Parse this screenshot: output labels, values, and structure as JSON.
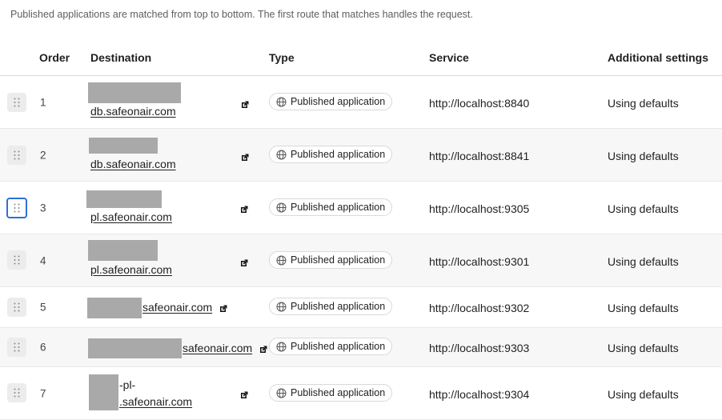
{
  "description": "Published applications are matched from top to bottom. The first route that matches handles the request.",
  "columns": {
    "order": "Order",
    "destination": "Destination",
    "type": "Type",
    "service": "Service",
    "settings": "Additional settings"
  },
  "rows": [
    {
      "order": "1",
      "domain": "db.safeonair.com",
      "type": "Published application",
      "service": "http://localhost:8840",
      "settings": "Using defaults"
    },
    {
      "order": "2",
      "domain": "db.safeonair.com",
      "type": "Published application",
      "service": "http://localhost:8841",
      "settings": "Using defaults"
    },
    {
      "order": "3",
      "domain": "pl.safeonair.com",
      "type": "Published application",
      "service": "http://localhost:9305",
      "settings": "Using defaults"
    },
    {
      "order": "4",
      "domain": "pl.safeonair.com",
      "type": "Published application",
      "service": "http://localhost:9301",
      "settings": "Using defaults"
    },
    {
      "order": "5",
      "domain": "safeonair.com",
      "type": "Published application",
      "service": "http://localhost:9302",
      "settings": "Using defaults"
    },
    {
      "order": "6",
      "domain": "safeonair.com",
      "type": "Published application",
      "service": "http://localhost:9303",
      "settings": "Using defaults"
    },
    {
      "order": "7",
      "domain_line1": "-pl-",
      "domain_line2": ".safeonair.com",
      "type": "Published application",
      "service": "http://localhost:9304",
      "settings": "Using defaults"
    }
  ],
  "icons": {
    "drag_handle": "drag-handle-icon",
    "external_link": "external-link-icon",
    "globe": "globe-icon"
  },
  "colors": {
    "focus_border": "#2f6fd6",
    "redaction": "#a9a9a9",
    "alt_row": "#f7f7f7"
  }
}
